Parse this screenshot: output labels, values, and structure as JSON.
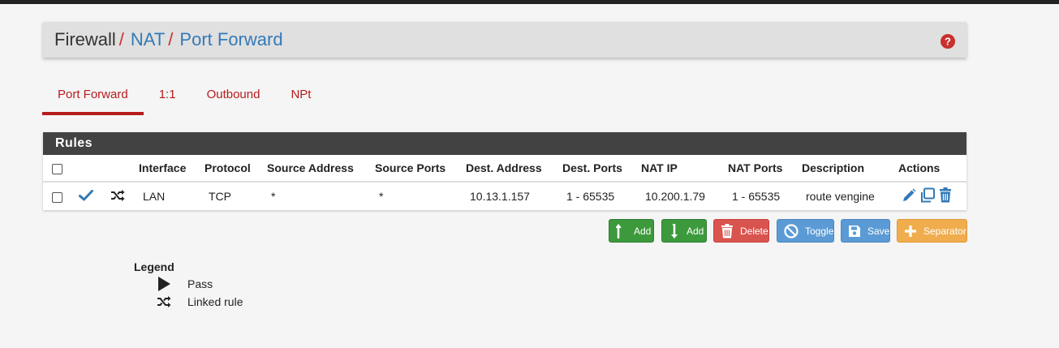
{
  "breadcrumb": {
    "root": "Firewall",
    "separator": "/",
    "level1": "NAT",
    "level2": "Port Forward"
  },
  "help_icon": "question-circle-icon",
  "tabs": [
    {
      "label": "Port Forward",
      "active": true
    },
    {
      "label": "1:1",
      "active": false
    },
    {
      "label": "Outbound",
      "active": false
    },
    {
      "label": "NPt",
      "active": false
    }
  ],
  "rules": {
    "heading": "Rules",
    "columns": [
      "Interface",
      "Protocol",
      "Source Address",
      "Source Ports",
      "Dest. Address",
      "Dest. Ports",
      "NAT IP",
      "NAT Ports",
      "Description",
      "Actions"
    ],
    "rows": [
      {
        "status_icon": "check-icon",
        "link_icon": "random-icon",
        "interface": "LAN",
        "protocol": "TCP",
        "source_address": "*",
        "source_ports": "*",
        "dest_address": "10.13.1.157",
        "dest_ports": "1 - 65535",
        "nat_ip": "10.200.1.79",
        "nat_ports": "1 - 65535",
        "description": "route vengine"
      }
    ]
  },
  "buttons": {
    "add_top": "Add",
    "add_bottom": "Add",
    "delete": "Delete",
    "toggle": "Toggle",
    "save": "Save",
    "separator": "Separator"
  },
  "legend": {
    "title": "Legend",
    "items": [
      {
        "icon": "play-icon",
        "label": "Pass"
      },
      {
        "icon": "random-icon",
        "label": "Linked rule"
      }
    ]
  },
  "colors": {
    "accent_red": "#b71c1c",
    "link_blue": "#337ab7",
    "panel_dark": "#424242",
    "green": "#3c9a3c",
    "orange": "#f0ad4e"
  }
}
